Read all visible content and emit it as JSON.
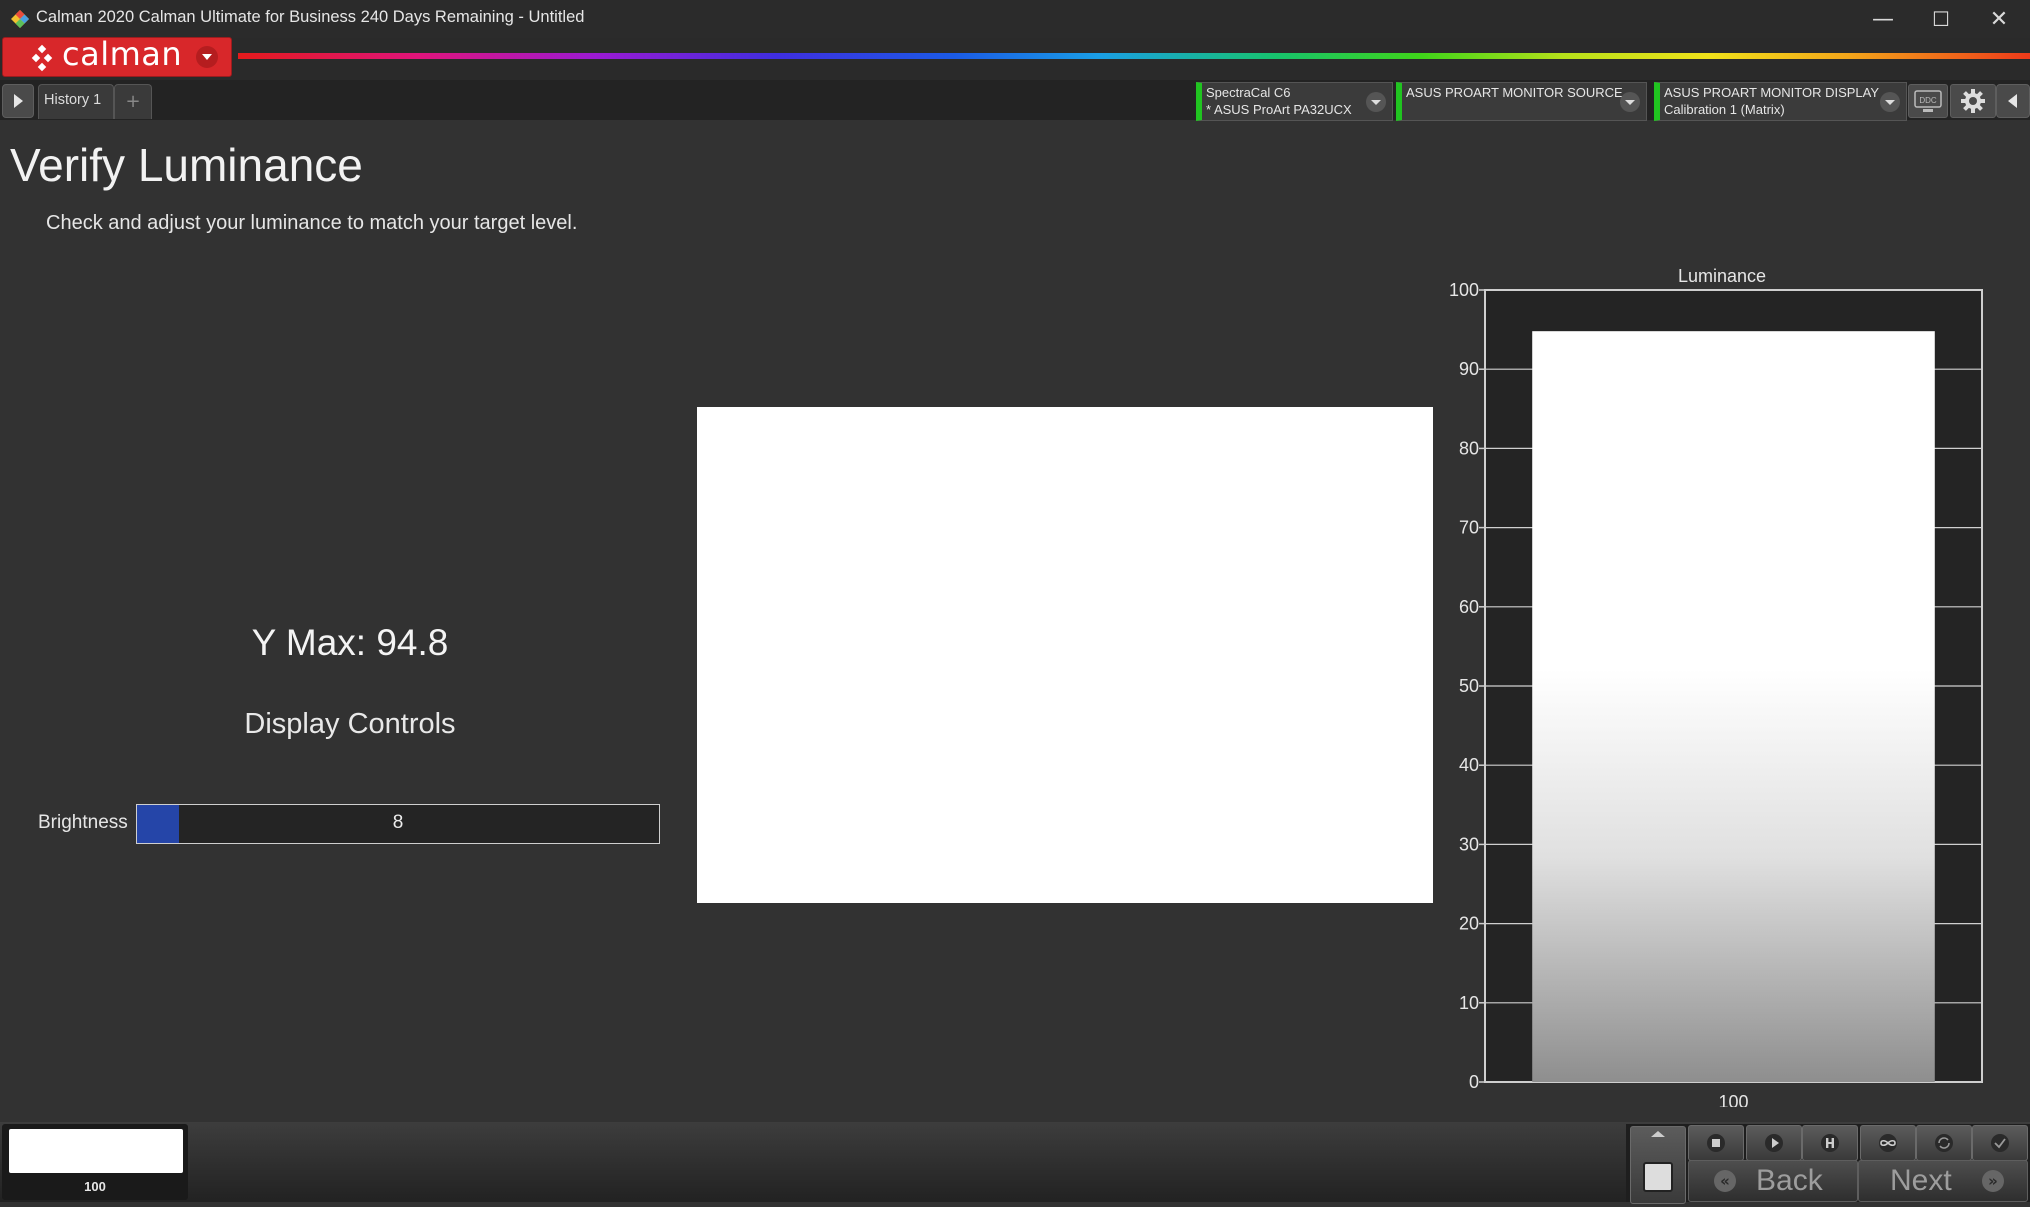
{
  "window": {
    "title": "Calman 2020 Calman Ultimate for Business 240 Days Remaining  -  Untitled",
    "minimize": "—",
    "maximize": "☐",
    "close": "✕"
  },
  "brand": {
    "logo_text": "calman",
    "accent": "#d8272a"
  },
  "tabs": [
    {
      "label": "History 1"
    }
  ],
  "add_tab": "+",
  "devices": [
    {
      "line1": "SpectraCal C6",
      "line2": "* ASUS ProArt PA32UCX",
      "status_color": "#20c420"
    },
    {
      "line1": "ASUS PROART MONITOR SOURCE",
      "line2": "",
      "status_color": "#20c420"
    },
    {
      "line1": "ASUS PROART MONITOR DISPLAY",
      "line2": "Calibration 1 (Matrix)",
      "status_color": "#20c420"
    }
  ],
  "ddc_label": "DDC",
  "page": {
    "title": "Verify Luminance",
    "subtitle": "Check and adjust your luminance to match your target level."
  },
  "readout": {
    "y_max": "Y Max: 94.8"
  },
  "display_controls": {
    "title": "Display Controls",
    "brightness": {
      "label": "Brightness",
      "value": "8",
      "fill_color": "#2545a8"
    }
  },
  "chart_data": {
    "type": "bar",
    "title": "Luminance",
    "categories": [
      "100"
    ],
    "values": [
      94.8
    ],
    "ylim": [
      0,
      100
    ],
    "yticks": [
      0,
      10,
      20,
      30,
      40,
      50,
      60,
      70,
      80,
      90,
      100
    ],
    "grid": true
  },
  "footer": {
    "thumbnail_label": "100",
    "back_label": "Back",
    "next_label": "Next"
  }
}
